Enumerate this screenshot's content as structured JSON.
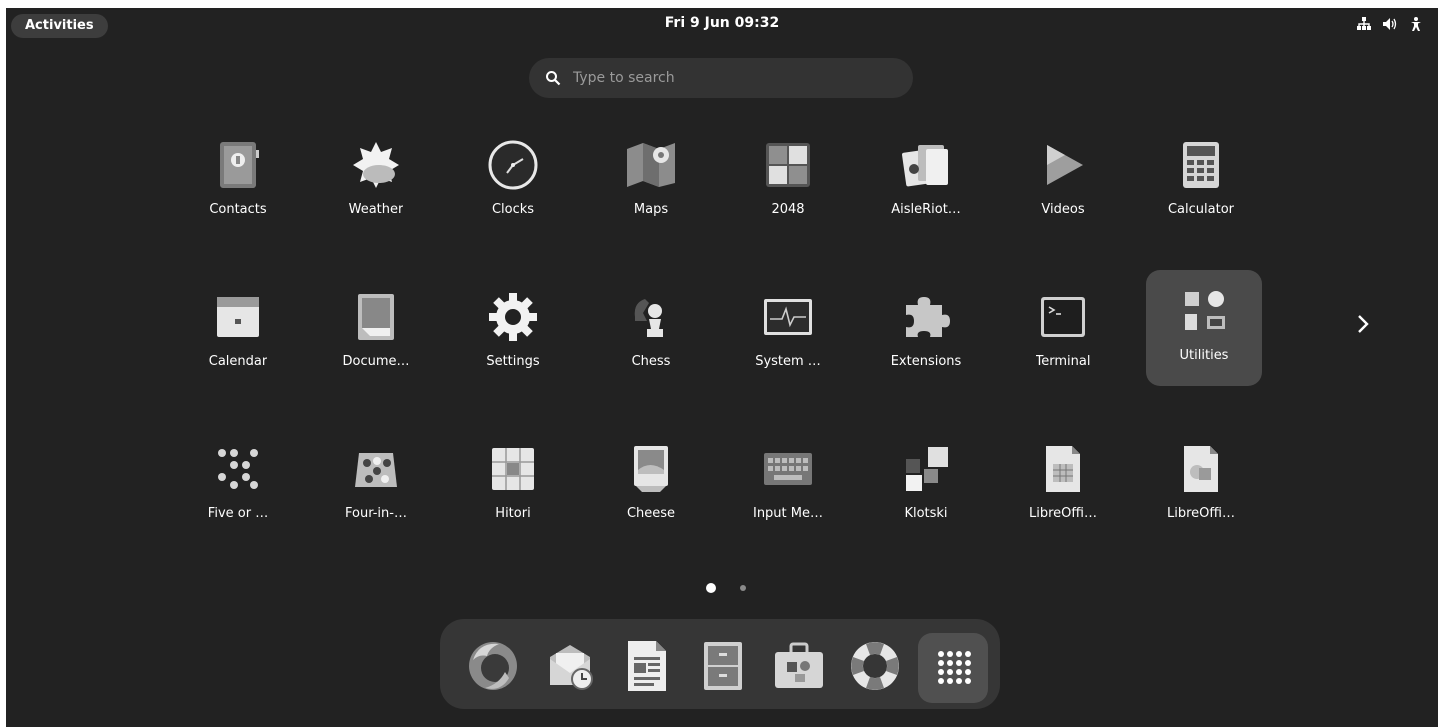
{
  "topbar": {
    "activities_label": "Activities",
    "datetime": "Fri 9 Jun  09:32",
    "status_icons": [
      "network-icon",
      "volume-icon",
      "accessibility-icon"
    ]
  },
  "search": {
    "placeholder": "Type to search"
  },
  "app_grid": {
    "rows": [
      [
        {
          "label": "Contacts",
          "icon": "contacts-icon"
        },
        {
          "label": "Weather",
          "icon": "weather-icon"
        },
        {
          "label": "Clocks",
          "icon": "clocks-icon"
        },
        {
          "label": "Maps",
          "icon": "maps-icon"
        },
        {
          "label": "2048",
          "icon": "game-2048-icon"
        },
        {
          "label": "AisleRiot…",
          "icon": "cards-icon"
        },
        {
          "label": "Videos",
          "icon": "videos-icon"
        },
        {
          "label": "Calculator",
          "icon": "calculator-icon"
        }
      ],
      [
        {
          "label": "Calendar",
          "icon": "calendar-icon"
        },
        {
          "label": "Docume…",
          "icon": "document-viewer-icon"
        },
        {
          "label": "Settings",
          "icon": "gear-icon"
        },
        {
          "label": "Chess",
          "icon": "chess-icon"
        },
        {
          "label": "System …",
          "icon": "system-monitor-icon"
        },
        {
          "label": "Extensions",
          "icon": "puzzle-icon"
        },
        {
          "label": "Terminal",
          "icon": "terminal-icon"
        },
        {
          "label": "Utilities",
          "icon": "utilities-folder-icon",
          "highlighted": true
        }
      ],
      [
        {
          "label": "Five or …",
          "icon": "five-or-more-icon"
        },
        {
          "label": "Four-in-…",
          "icon": "four-in-a-row-icon"
        },
        {
          "label": "Hitori",
          "icon": "hitori-icon"
        },
        {
          "label": "Cheese",
          "icon": "cheese-icon"
        },
        {
          "label": "Input Me…",
          "icon": "keyboard-icon"
        },
        {
          "label": "Klotski",
          "icon": "klotski-icon"
        },
        {
          "label": "LibreOffi…",
          "icon": "libreoffice-calc-icon"
        },
        {
          "label": "LibreOffi…",
          "icon": "libreoffice-draw-icon"
        }
      ]
    ],
    "next_page_icon": "chevron-right-icon",
    "pages": 2,
    "current_page": 1
  },
  "dash": {
    "items": [
      {
        "name": "firefox",
        "icon": "firefox-icon"
      },
      {
        "name": "mail",
        "icon": "mail-client-icon"
      },
      {
        "name": "writer",
        "icon": "libreoffice-writer-icon"
      },
      {
        "name": "files",
        "icon": "file-cabinet-icon"
      },
      {
        "name": "software",
        "icon": "software-store-icon"
      },
      {
        "name": "help",
        "icon": "help-lifebuoy-icon"
      },
      {
        "name": "show-apps",
        "icon": "app-grid-icon"
      }
    ]
  },
  "colors": {
    "background": "#222222",
    "panel": "#363636",
    "highlight": "#4a4a4a",
    "text": "#ffffff"
  }
}
